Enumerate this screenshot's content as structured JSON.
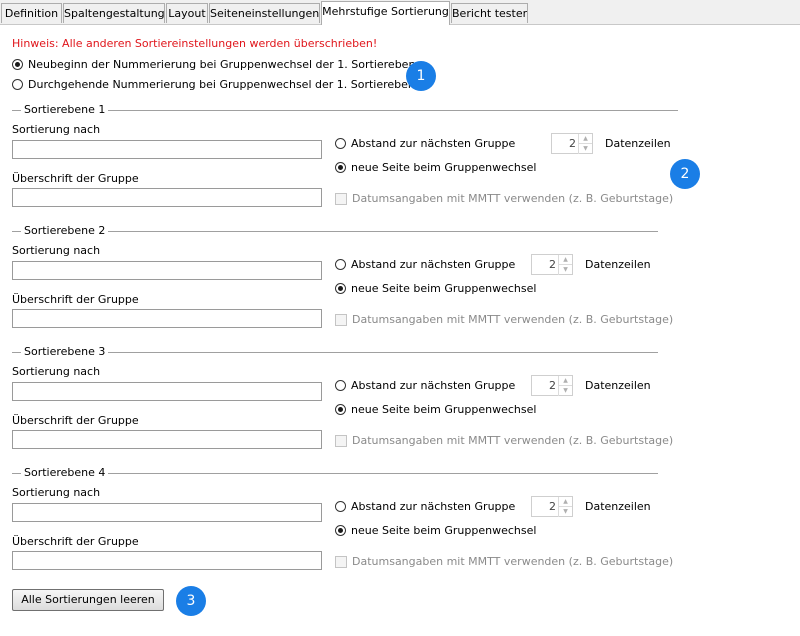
{
  "tabs": [
    {
      "label": "Definition"
    },
    {
      "label": "Spaltengestaltung"
    },
    {
      "label": "Layout"
    },
    {
      "label": "Seiteneinstellungen"
    },
    {
      "label": "Mehrstufige Sortierung"
    },
    {
      "label": "Bericht testen"
    }
  ],
  "active_tab": "Mehrstufige Sortierung",
  "hint": "Hinweis: Alle anderen Sortiereinstellungen werden überschrieben!",
  "numbering": {
    "option1": "Neubeginn der Nummerierung bei Gruppenwechsel der 1. Sortierebene",
    "option2": "Durchgehende Nummerierung bei Gruppenwechsel der 1. Sortierebene",
    "selected": "option1"
  },
  "levels": [
    {
      "title": "Sortierebene 1",
      "sort_label": "Sortierung nach",
      "sort_value": "",
      "heading_label": "Überschrift der Gruppe",
      "heading_value": "",
      "gap_label": "Abstand zur nächsten Gruppe",
      "gap_value": "2",
      "gap_unit": "Datenzeilen",
      "newpage_label": "neue Seite beim Gruppenwechsel",
      "selected": "newpage",
      "date_label": "Datumsangaben mit MMTT verwenden (z. B. Geburtstage)",
      "date_checked": false
    },
    {
      "title": "Sortierebene 2",
      "sort_label": "Sortierung nach",
      "sort_value": "",
      "heading_label": "Überschrift der Gruppe",
      "heading_value": "",
      "gap_label": "Abstand zur nächsten Gruppe",
      "gap_value": "2",
      "gap_unit": "Datenzeilen",
      "newpage_label": "neue Seite beim Gruppenwechsel",
      "selected": "newpage",
      "date_label": "Datumsangaben mit MMTT verwenden (z. B. Geburtstage)",
      "date_checked": false
    },
    {
      "title": "Sortierebene 3",
      "sort_label": "Sortierung nach",
      "sort_value": "",
      "heading_label": "Überschrift der Gruppe",
      "heading_value": "",
      "gap_label": "Abstand zur nächsten Gruppe",
      "gap_value": "2",
      "gap_unit": "Datenzeilen",
      "newpage_label": "neue Seite beim Gruppenwechsel",
      "selected": "newpage",
      "date_label": "Datumsangaben mit MMTT verwenden (z. B. Geburtstage)",
      "date_checked": false
    },
    {
      "title": "Sortierebene 4",
      "sort_label": "Sortierung nach",
      "sort_value": "",
      "heading_label": "Überschrift der Gruppe",
      "heading_value": "",
      "gap_label": "Abstand zur nächsten Gruppe",
      "gap_value": "2",
      "gap_unit": "Datenzeilen",
      "newpage_label": "neue Seite beim Gruppenwechsel",
      "selected": "newpage",
      "date_label": "Datumsangaben mit MMTT verwenden (z. B. Geburtstage)",
      "date_checked": false
    }
  ],
  "clear_button": "Alle Sortierungen leeren",
  "badges": [
    "1",
    "2",
    "3"
  ],
  "colors": {
    "hint": "#e0151b",
    "badge": "#1a7ee6"
  }
}
